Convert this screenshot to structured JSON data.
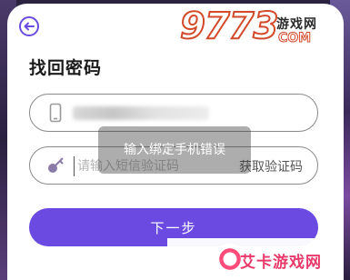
{
  "page": {
    "title": "找回密码"
  },
  "form": {
    "code_placeholder": "请输入短信验证码",
    "get_code_label": "获取验证码",
    "next_label": "下一步"
  },
  "toast": {
    "message": "输入绑定手机错误"
  },
  "watermarks": {
    "top_digits": "9773",
    "top_cn": "游戏网",
    "top_com": "COM",
    "bottom_text": "艾卡游戏网"
  },
  "colors": {
    "accent": "#6a4ae0",
    "toast_bg": "rgba(60,60,60,0.42)"
  }
}
